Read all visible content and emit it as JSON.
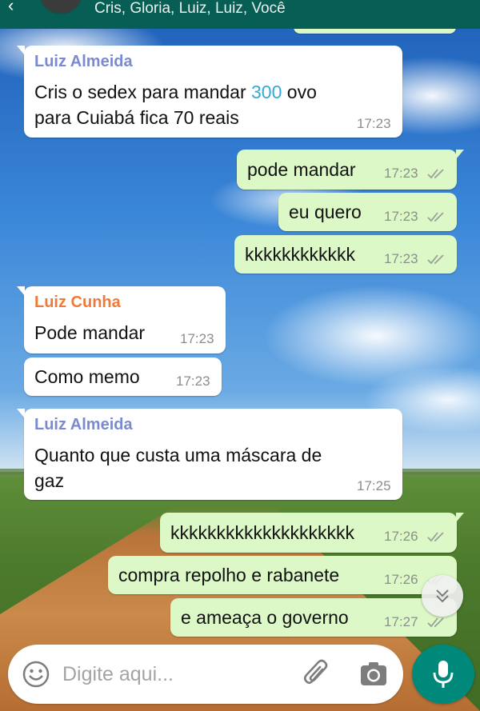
{
  "header": {
    "participants": "Cris, Gloria, Luiz, Luiz, Você"
  },
  "colors": {
    "header": "#075e54",
    "outgoing_bubble": "#dcf8c6",
    "incoming_bubble": "#ffffff",
    "sender_luiz_almeida": "#7a8ad0",
    "sender_luiz_cunha": "#f07a3a",
    "highlight_number": "#34a8d8",
    "mic_button": "#00897b"
  },
  "messages": [
    {
      "direction": "in",
      "sender": "Luiz Almeida",
      "text_before": "Cris o sedex para mandar ",
      "text_highlight": "300",
      "text_after": " ovo",
      "text_line2": "para Cuiabá fica 70 reais",
      "time": "17:23"
    },
    {
      "direction": "out",
      "text": "pode mandar",
      "time": "17:23",
      "status": "read"
    },
    {
      "direction": "out",
      "text": "eu quero",
      "time": "17:23",
      "status": "read"
    },
    {
      "direction": "out",
      "text": "kkkkkkkkkkkk",
      "time": "17:23",
      "status": "read"
    },
    {
      "direction": "in",
      "sender": "Luiz Cunha",
      "text": "Pode mandar",
      "time": "17:23"
    },
    {
      "direction": "in",
      "text": "Como memo",
      "time": "17:23"
    },
    {
      "direction": "in",
      "sender": "Luiz Almeida",
      "text_line1": "Quanto que custa uma máscara de",
      "text_line2": "gaz",
      "time": "17:25"
    },
    {
      "direction": "out",
      "text": "kkkkkkkkkkkkkkkkkkkk",
      "time": "17:26",
      "status": "read"
    },
    {
      "direction": "out",
      "text": "compra repolho e rabanete",
      "time": "17:26",
      "status": "read"
    },
    {
      "direction": "out",
      "text": "e ameaça o governo",
      "time": "17:27",
      "status": "read"
    }
  ],
  "composer": {
    "placeholder": "Digite aqui..."
  },
  "icons": {
    "back": "arrow-left-icon",
    "emoji": "smiley-icon",
    "attach": "paperclip-icon",
    "camera": "camera-icon",
    "mic": "microphone-icon",
    "scroll": "double-chevron-down-icon",
    "read_receipt": "double-check-icon"
  }
}
